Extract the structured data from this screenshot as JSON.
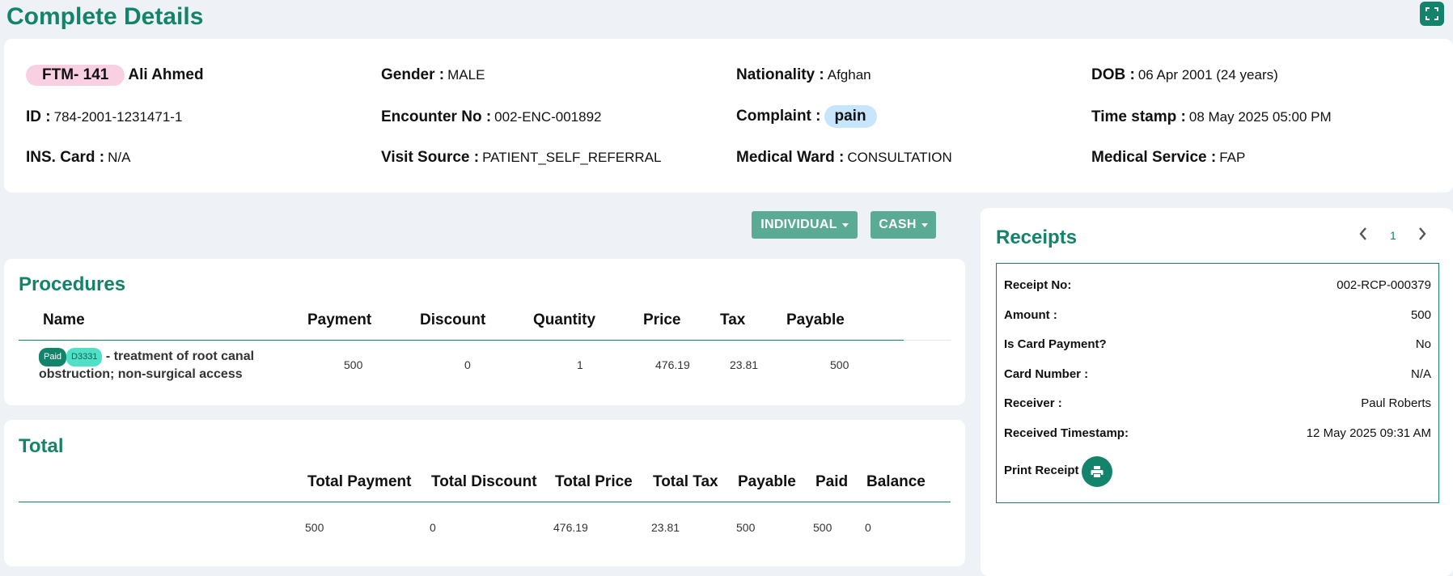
{
  "header": {
    "title": "Complete Details"
  },
  "patient": {
    "mrn": "FTM- 141",
    "name": "Ali Ahmed",
    "gender_label": "Gender :",
    "gender": "MALE",
    "nationality_label": "Nationality :",
    "nationality": "Afghan",
    "dob_label": "DOB :",
    "dob": "06 Apr 2001 (24 years)",
    "id_label": "ID :",
    "id": "784-2001-1231471-1",
    "encounter_label": "Encounter No :",
    "encounter": "002-ENC-001892",
    "complaint_label": "Complaint :",
    "complaint": "pain",
    "timestamp_label": "Time stamp :",
    "timestamp": "08 May 2025 05:00 PM",
    "ins_label": "INS. Card :",
    "ins": "N/A",
    "visit_source_label": "Visit Source :",
    "visit_source": "PATIENT_SELF_REFERRAL",
    "ward_label": "Medical Ward :",
    "ward": "CONSULTATION",
    "service_label": "Medical Service :",
    "service": "FAP"
  },
  "toolbar": {
    "individual": "INDIVIDUAL",
    "cash": "CASH"
  },
  "procedures": {
    "title": "Procedures",
    "columns": [
      "Name",
      "Payment",
      "Discount",
      "Quantity",
      "Price",
      "Tax",
      "Payable"
    ],
    "rows": [
      {
        "status": "Paid",
        "code": "D3331",
        "name": "- treatment of root canal obstruction; non-surgical access",
        "payment": "500",
        "discount": "0",
        "quantity": "1",
        "price": "476.19",
        "tax": "23.81",
        "payable": "500"
      }
    ]
  },
  "total": {
    "title": "Total",
    "columns": [
      "Total Payment",
      "Total Discount",
      "Total Price",
      "Total Tax",
      "Payable",
      "Paid",
      "Balance"
    ],
    "values": [
      "500",
      "0",
      "476.19",
      "23.81",
      "500",
      "500",
      "0"
    ]
  },
  "receipts": {
    "title": "Receipts",
    "page": "1",
    "fields": [
      {
        "label": "Receipt No:",
        "value": "002-RCP-000379"
      },
      {
        "label": "Amount :",
        "value": "500"
      },
      {
        "label": "Is Card Payment?",
        "value": "No"
      },
      {
        "label": "Card Number :",
        "value": "N/A"
      },
      {
        "label": "Receiver :",
        "value": "Paul Roberts"
      },
      {
        "label": "Received Timestamp:",
        "value": "12 May 2025 09:31 AM"
      }
    ],
    "print_label": "Print Receipt"
  },
  "colors": {
    "accent": "#13836b",
    "button": "#5bab94",
    "mrn_pill": "#f9cfe2",
    "complaint_pill": "#c8e6fb"
  },
  "icons": {
    "expand": "expand-icon",
    "prev": "chevron-left-icon",
    "next": "chevron-right-icon",
    "print": "printer-icon"
  }
}
